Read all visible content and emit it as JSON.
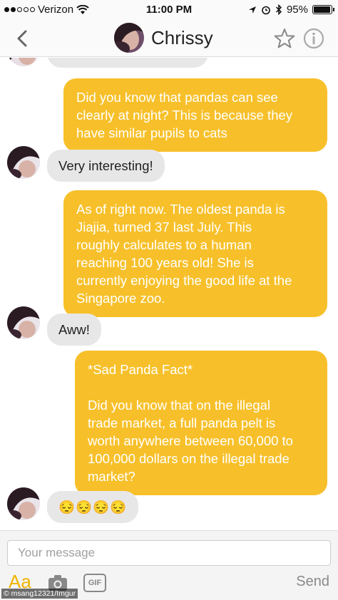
{
  "status_bar": {
    "carrier": "Verizon",
    "time": "11:00 PM",
    "battery": "95%",
    "battery_level": 0.95
  },
  "header": {
    "contact_name": "Chrissy"
  },
  "messages": [
    {
      "side": "in",
      "text": ""
    },
    {
      "side": "out",
      "lines": [
        "Did you know that pandas can see",
        "clearly at night? This is because they",
        "have similar pupils to cats"
      ]
    },
    {
      "side": "in",
      "text": "Very interesting!"
    },
    {
      "side": "out",
      "lines": [
        "As of right now. The oldest panda is",
        "Jiajia, turned 37 last July. This",
        "roughly calculates to a human",
        "reaching 100 years old! She is",
        "currently enjoying the good life at the",
        "Singapore zoo."
      ]
    },
    {
      "side": "in",
      "text": "Aww!"
    },
    {
      "side": "out",
      "lines": [
        "*Sad Panda Fact*",
        "",
        "Did you know that on the illegal",
        "trade market, a full panda pelt is",
        "worth anywhere between 60,000 to",
        "100,000 dollars on the illegal trade",
        "market?"
      ]
    },
    {
      "side": "in",
      "text": "😔😔😔😔"
    }
  ],
  "composer": {
    "placeholder": "Your message",
    "font_label": "Aa",
    "gif_label": "GIF",
    "send_label": "Send"
  },
  "watermark": "© msang12321/Imgur",
  "colors": {
    "outgoing_bubble": "#f7c02a",
    "incoming_bubble": "#e7e7e7",
    "accent": "#f0b400"
  }
}
